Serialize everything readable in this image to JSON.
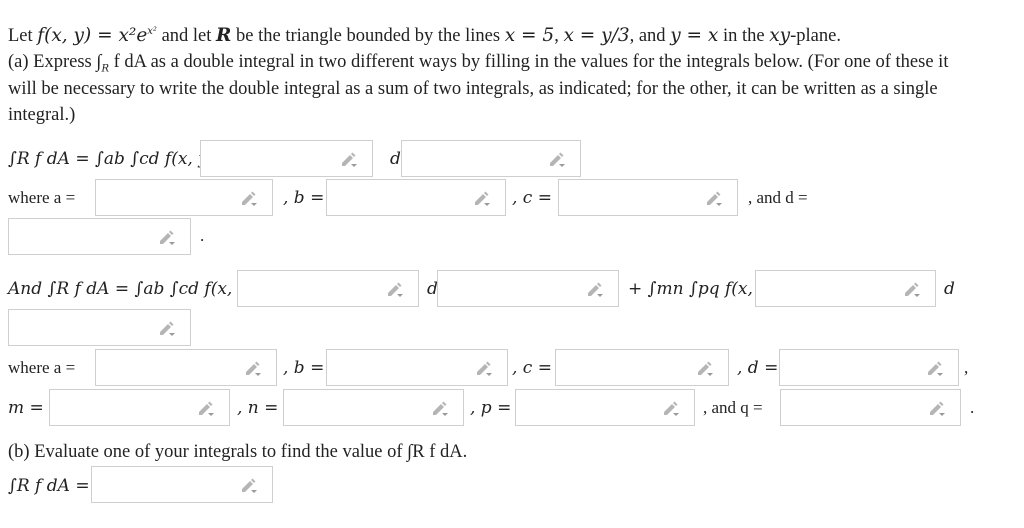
{
  "problem": {
    "intro": {
      "lead": "Let ",
      "func": "f(x, y) = x²e",
      "exp": "x²",
      "mid": " and let ",
      "region": "R",
      "rest": " be the triangle bounded by the lines ",
      "line1": "x = 5",
      "sep1": ", ",
      "line2": "x = y/3",
      "sep2": ", and ",
      "line3": "y = x",
      "tail": " in the ",
      "plane": "xy",
      "end": "-plane."
    },
    "part_a": {
      "label": "(a)",
      "line1": " Express ∫",
      "line1_sub": "R",
      "line1_rest": " f dA as a double integral in two different ways by filling in the values for the integrals below. (For one of these it",
      "line2": "will be necessary to write the double integral as a sum of two integrals, as indicated; for the other, it can be written as a single",
      "line3": "integral.)"
    },
    "form1": {
      "lhs": "∫R f dA = ∫ab ∫cd f(x, y) d",
      "d_label": "d",
      "where_a": "where a =",
      "b_label": ", b =",
      "c_label": ", c =",
      "and_d_label": ", and d =",
      "period": "."
    },
    "form2": {
      "lhs": "And ∫R f dA = ∫ab ∫cd f(x, y) d",
      "d_label": "d",
      "plus_term": "+ ∫mn ∫pq f(x, y) d",
      "d_label2": "d",
      "where_a": "where a =",
      "b_label": ", b =",
      "c_label": ", c =",
      "d_label3": ", d =",
      "comma": ",",
      "m_label": "m =",
      "n_label": ", n =",
      "p_label": ", p =",
      "and_q_label": ", and q =",
      "period": "."
    },
    "part_b": {
      "label": "(b)",
      "text": " Evaluate one of your integrals to find the value of ∫R f dA.",
      "lhs": "∫R f dA ="
    }
  },
  "inputs": {
    "form1_var1": "",
    "form1_var2": "",
    "form1_a": "",
    "form1_b": "",
    "form1_c": "",
    "form1_d": "",
    "form2_var1": "",
    "form2_var2": "",
    "form2_var3": "",
    "form2_var4": "",
    "form2_a": "",
    "form2_b": "",
    "form2_c": "",
    "form2_d": "",
    "form2_m": "",
    "form2_n": "",
    "form2_p": "",
    "form2_q": "",
    "answer": ""
  },
  "icons": {
    "input_tool": "pencil-dropdown-icon"
  },
  "colors": {
    "text": "#222222",
    "border": "#cfcfcf",
    "icon": "#b0b0b0"
  }
}
